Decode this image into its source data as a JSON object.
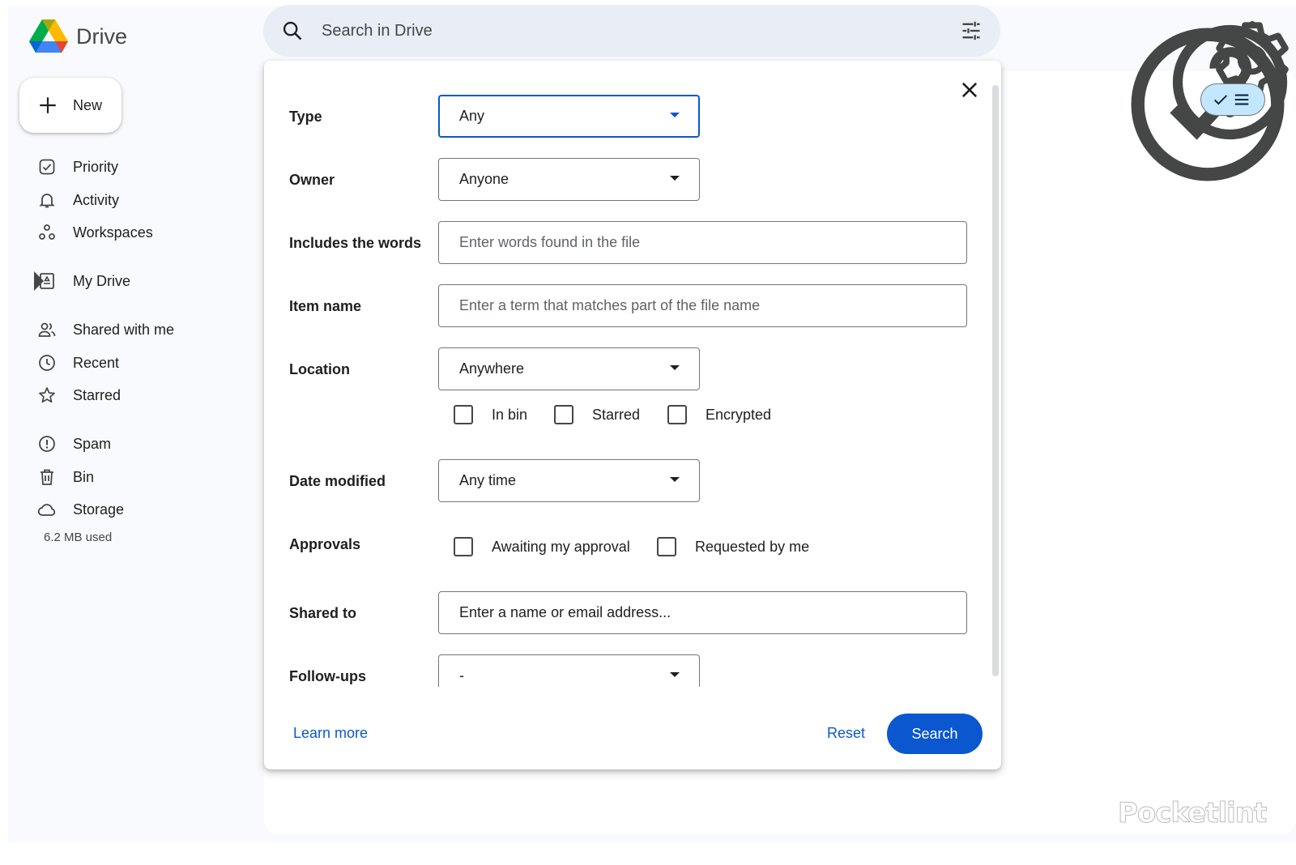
{
  "app": {
    "name": "Drive"
  },
  "search": {
    "placeholder": "Search in Drive"
  },
  "sidebar": {
    "new_label": "New",
    "items": [
      {
        "label": "Priority",
        "icon": "priority-icon"
      },
      {
        "label": "Activity",
        "icon": "bell-icon"
      },
      {
        "label": "Workspaces",
        "icon": "workspaces-icon"
      },
      {
        "label": "My Drive",
        "icon": "my-drive-icon"
      },
      {
        "label": "Shared with me",
        "icon": "shared-people-icon"
      },
      {
        "label": "Recent",
        "icon": "clock-icon"
      },
      {
        "label": "Starred",
        "icon": "star-icon"
      },
      {
        "label": "Spam",
        "icon": "spam-icon"
      },
      {
        "label": "Bin",
        "icon": "trash-icon"
      },
      {
        "label": "Storage",
        "icon": "cloud-icon"
      }
    ],
    "storage_used": "6.2 MB used"
  },
  "advanced_search": {
    "fields": {
      "type": {
        "label": "Type",
        "value": "Any"
      },
      "owner": {
        "label": "Owner",
        "value": "Anyone"
      },
      "includes_words": {
        "label": "Includes the words",
        "placeholder": "Enter words found in the file"
      },
      "item_name": {
        "label": "Item name",
        "placeholder": "Enter a term that matches part of the file name"
      },
      "location": {
        "label": "Location",
        "value": "Anywhere"
      },
      "date_modified": {
        "label": "Date modified",
        "value": "Any time"
      },
      "approvals": {
        "label": "Approvals"
      },
      "shared_to": {
        "label": "Shared to",
        "placeholder": "Enter a name or email address..."
      },
      "follow_ups": {
        "label": "Follow-ups",
        "value": "-"
      }
    },
    "location_checkboxes": {
      "in_bin": "In bin",
      "starred": "Starred",
      "encrypted": "Encrypted"
    },
    "approval_checkboxes": {
      "awaiting": "Awaiting my approval",
      "requested": "Requested by me"
    },
    "learn_more": "Learn more",
    "reset": "Reset",
    "search": "Search"
  },
  "watermark": "Pocketlint",
  "colors": {
    "accent": "#0b57d0",
    "surface": "#f8fafd",
    "search_bg": "#e9eef6",
    "toggle_bg": "#c2e7ff"
  }
}
